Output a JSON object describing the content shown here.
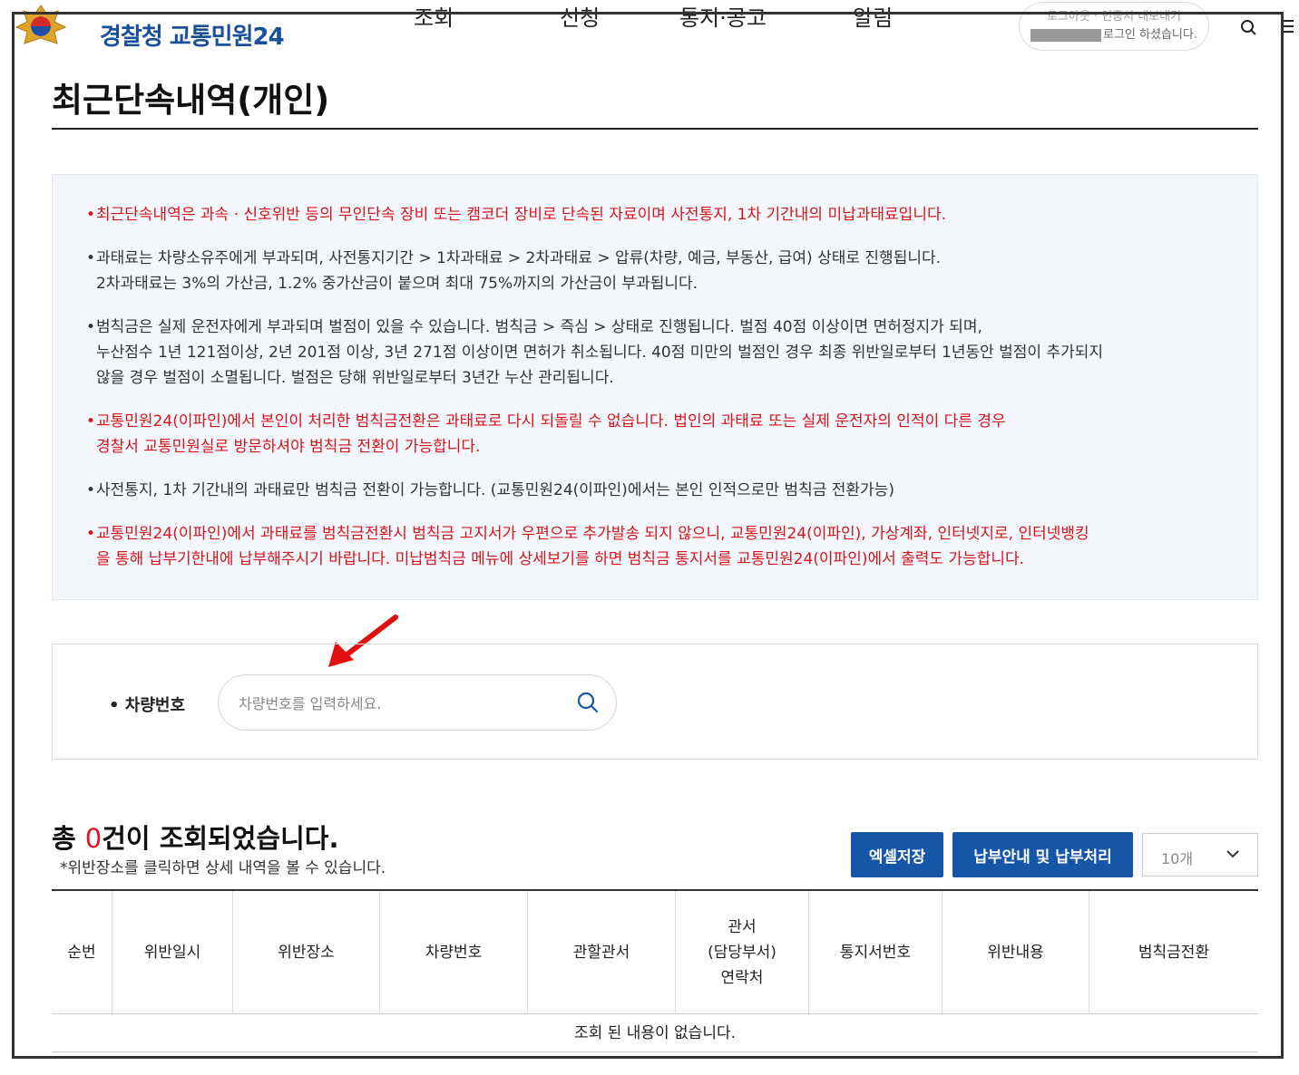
{
  "header": {
    "logo_text": "경찰청 교통민원24",
    "nav": [
      "조회",
      "신청",
      "통지·공고",
      "알림"
    ],
    "user_line1": "로그아웃 · 인증서 내보내기",
    "user_line2": "로그인 하셨습니다."
  },
  "page_title": "최근단속내역(개인)",
  "notice": {
    "bullet": "•",
    "items": [
      {
        "lines": [
          "최근단속내역은 과속 · 신호위반 등의 무인단속 장비 또는 캠코더 장비로 단속된 자료이며 사전통지, 1차 기간내의 미납과태료입니다."
        ]
      },
      {
        "lines": [
          "과태료는 차량소유주에게 부과되며, 사전통지기간 > 1차과태료 > 2차과태료 > 압류(차량, 예금, 부동산, 급여) 상태로 진행됩니다.",
          "2차과태료는 3%의 가산금, 1.2% 중가산금이 붙으며 최대 75%까지의 가산금이 부과됩니다."
        ]
      },
      {
        "lines": [
          "범칙금은 실제 운전자에게 부과되며 벌점이 있을 수 있습니다. 범칙금 > 즉심 > 상태로 진행됩니다. 벌점 40점 이상이면 면허정지가 되며,",
          "누산점수 1년 121점이상, 2년 201점 이상, 3년 271점 이상이면 면허가 취소됩니다. 40점 미만의 벌점인 경우 최종 위반일로부터 1년동안 벌점이 추가되지",
          "않을 경우 벌점이 소멸됩니다. 벌점은 당해 위반일로부터 3년간 누산 관리됩니다."
        ]
      },
      {
        "lines": [
          "교통민원24(이파인)에서 본인이 처리한 범칙금전환은 과태료로 다시 되돌릴 수 없습니다. 법인의 과태료 또는 실제 운전자의 인적이 다른 경우",
          "경찰서 교통민원실로 방문하셔야 범칙금 전환이 가능합니다."
        ]
      },
      {
        "lines": [
          "사전통지, 1차 기간내의 과태료만 범칙금 전환이 가능합니다. (교통민원24(이파인)에서는 본인 인적으로만 범칙금 전환가능)"
        ]
      },
      {
        "lines": [
          "교통민원24(이파인)에서 과태료를 범칙금전환시 범칙금 고지서가 우편으로 추가발송 되지 않으니, 교통민원24(이파인), 가상계좌, 인터넷지로, 인터넷뱅킹",
          "을 통해 납부기한내에 납부해주시기 바랍니다. 미납범칙금 메뉴에 상세보기를 하면 범칙금 통지서를 교통민원24(이파인)에서 출력도 가능합니다."
        ]
      }
    ]
  },
  "search": {
    "label": "• 차량번호",
    "placeholder": "차량번호를 입력하세요.",
    "value": ""
  },
  "results": {
    "prefix": "총 ",
    "count": "0",
    "suffix": "건이 조회되었습니다.",
    "hint": "*위반장소를 클릭하면 상세 내역을 볼 수 있습니다.",
    "excel_button": "엑셀저장",
    "pay_button": "납부안내 및 납부처리",
    "page_size": "10개"
  },
  "table": {
    "columns": [
      "순번",
      "위반일시",
      "위반장소",
      "차량번호",
      "관할관서",
      "관서\n(담당부서)\n연락처",
      "통지서번호",
      "위반내용",
      "범칙금전환"
    ],
    "empty_message": "조회 된 내용이 없습니다."
  },
  "colors": {
    "brand_blue": "#1556a8",
    "logo_blue": "#1a4f9c",
    "notice_red": "#d6141c",
    "notice_bg": "#f3f7fb",
    "arrow_red": "#e01010"
  },
  "icons": {
    "emblem": "police-emblem-icon",
    "search": "search-icon",
    "menu": "hamburger-menu-icon",
    "dropdown": "chevron-down-icon",
    "annotation": "red-arrow-icon"
  }
}
